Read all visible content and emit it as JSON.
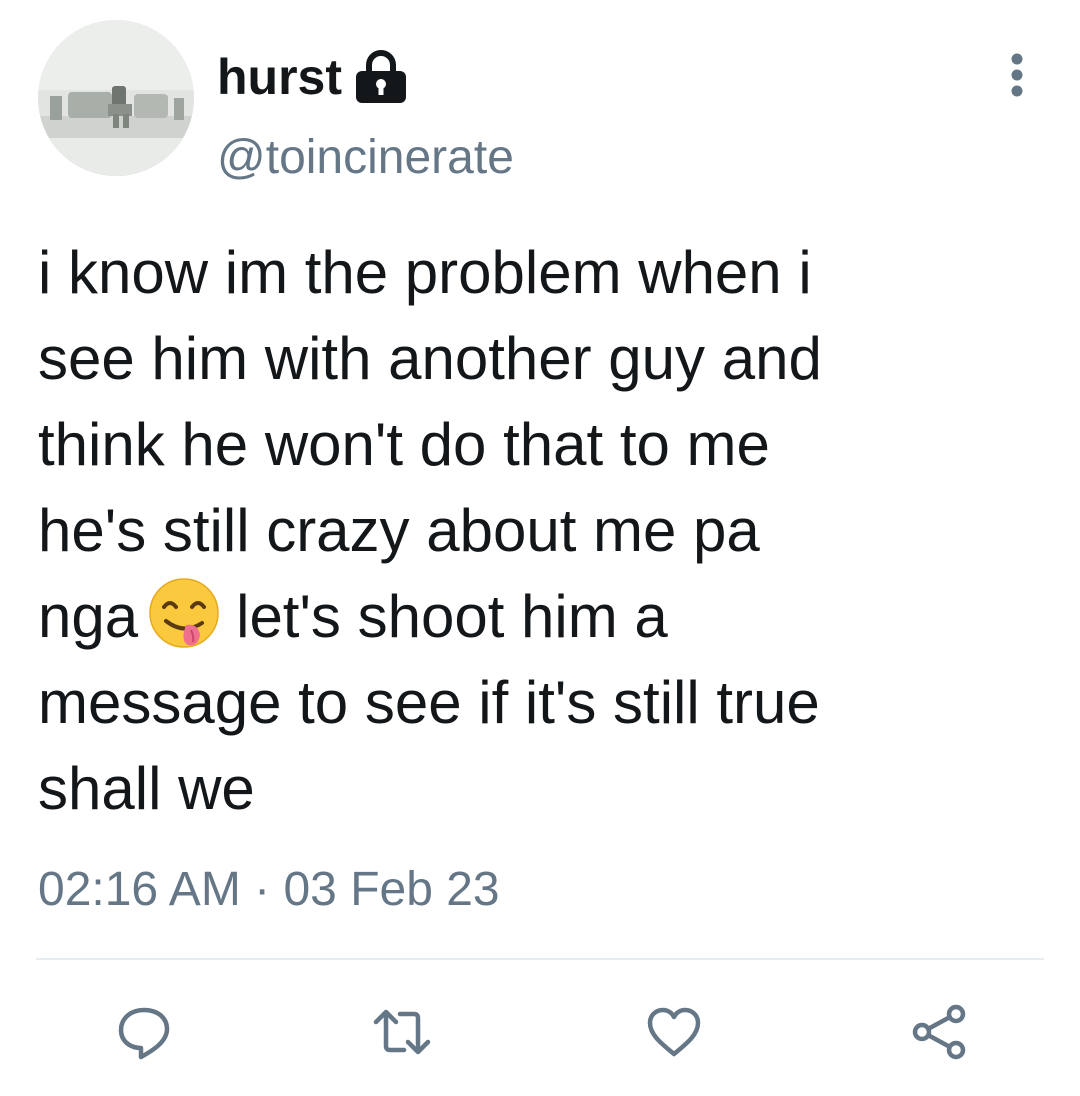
{
  "tweet": {
    "author": {
      "display_name": "hurst",
      "handle": "@toincinerate",
      "protected_icon": "lock-icon"
    },
    "text_before_emoji": "i know im the problem when i\nsee him with another guy and\nthink he won't do that to me\nhe's still crazy about me pa\nnga",
    "emoji": "face-savoring-food-emoji",
    "text_after_emoji": "let's shoot him a\nmessage to see if it's still true\nshall we",
    "timestamp": "02:16 AM · 03 Feb 23"
  },
  "actions": [
    {
      "icon": "reply-icon"
    },
    {
      "icon": "retweet-icon"
    },
    {
      "icon": "like-icon"
    },
    {
      "icon": "share-icon"
    }
  ],
  "colors": {
    "text": "#14171a",
    "secondary": "#657786",
    "divider": "#e6ecf0",
    "background": "#ffffff"
  }
}
